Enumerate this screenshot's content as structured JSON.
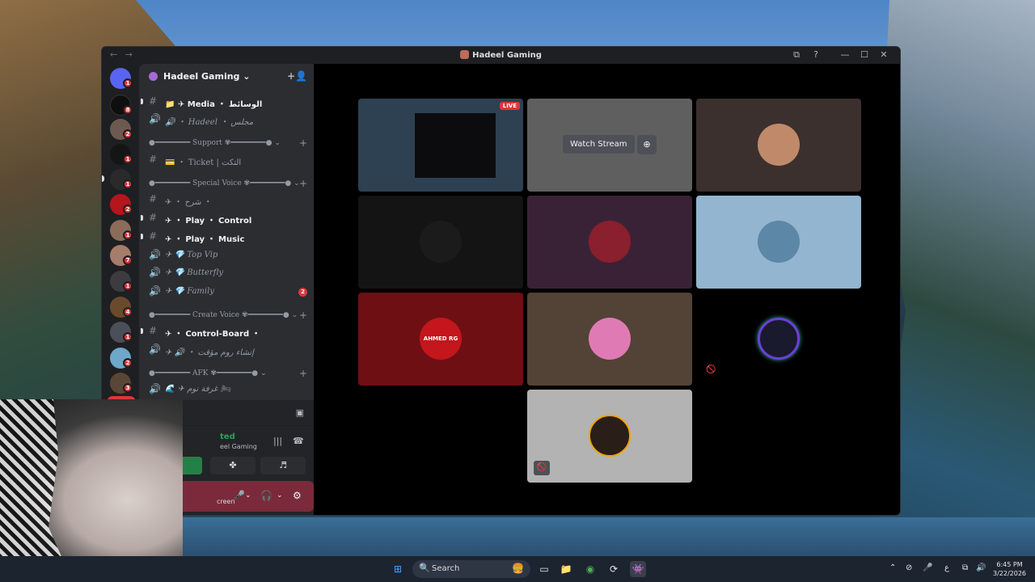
{
  "window": {
    "title": "Hadeel Gaming",
    "nav_back": "←",
    "nav_forward": "→",
    "controls": [
      "⧉",
      "?",
      "—",
      "☐",
      "✕"
    ]
  },
  "rail": {
    "badges": [
      "1",
      "8",
      "2",
      "1",
      "1",
      "2",
      "1",
      "7",
      "1",
      "4",
      "1",
      "2",
      "3"
    ],
    "new_label": "NEW"
  },
  "server": {
    "name": "Hadeel Gaming",
    "chevron": "⌄",
    "invite_icon": "+👤"
  },
  "channels": [
    {
      "icon": "#",
      "label": "📁 ✈ Media ・ الوسائط",
      "type": "text bold",
      "pinned": true
    },
    {
      "icon": "🔊",
      "label": "🔊 ・ Hadeel ・ مجلس",
      "type": "voice",
      "pinned": false
    },
    {
      "icon": "#",
      "label": "💳 ・ Ticket | التكت",
      "type": "text muted",
      "pinned": false
    },
    {
      "icon": "#",
      "label": "✈ ・ شرح ・",
      "type": "text muted",
      "pinned": false
    },
    {
      "icon": "#",
      "label": "✈ ・ Play ・ Control",
      "type": "text bold",
      "pinned": true
    },
    {
      "icon": "#",
      "label": "✈ ・ Play ・ Music",
      "type": "text bold",
      "pinned": true
    },
    {
      "icon": "🔊",
      "label": "✈ 💎 Top Vip",
      "type": "voice",
      "pinned": false
    },
    {
      "icon": "🔊",
      "label": "✈ 💎 Butterfly",
      "type": "voice",
      "pinned": false
    },
    {
      "icon": "🔊",
      "label": "✈ 💎 Family",
      "type": "voice",
      "pinned": false,
      "badge": "2"
    },
    {
      "icon": "#",
      "label": "✈ ・ Control-Board ・",
      "type": "text bold",
      "pinned": true
    },
    {
      "icon": "🔊",
      "label": "✈ 🔊 ・ إنشاء روم مؤقت",
      "type": "voice muted",
      "pinned": false
    },
    {
      "icon": "🔊",
      "label": "🌊 ✈ غرفة نوم 🛏",
      "type": "voice muted",
      "pinned": false
    }
  ],
  "categories": [
    {
      "label": "●━━━━━━━━ Support ✾━━━━━━━━● ⌄"
    },
    {
      "label": "●━━━━━━━━ Special Voice ✾━━━━━━━━● ⌄"
    },
    {
      "label": "●━━━━━━━━ Create Voice ✾━━━━━━━━● ⌄"
    },
    {
      "label": "●━━━━━━━━ AFK ✾━━━━━━━━● ⌄"
    }
  ],
  "voice_panel": {
    "status": "ted",
    "server": "eel Gaming",
    "screen_label": "creen",
    "wave_icon": "|||",
    "hangup_icon": "☎",
    "screen_share_icon": "▣",
    "activity_icon": "✤",
    "soundboard_icon": "♬",
    "mic_icon": "🎤",
    "headphone_icon": "🎧",
    "settings_icon": "⚙",
    "chev": "⌄"
  },
  "stage": {
    "live_label": "LIVE",
    "watch_label": "Watch Stream",
    "watch_icon": "⊕",
    "mute_icon": "🚫",
    "tile_colors": [
      "#2d4152",
      "#5f5f60",
      "#3b302e",
      "#141414",
      "#3a2236",
      "#93b5cf",
      "#6e0f14",
      "#524336",
      "#000000",
      "#b3b3b3"
    ],
    "avatar_colors": [
      "#c08a6a",
      "#1b1b1b",
      "#8a1f2e",
      "#5c87a6",
      "#c4161c",
      "#e07ab4",
      "#1a1a2e",
      "#2a1e18"
    ],
    "avatar_text": "AHMED RG"
  },
  "taskbar": {
    "search_label": "Search",
    "search_icon": "🔍",
    "start_icon": "⊞",
    "apps": [
      "🍔",
      "▭",
      "📁",
      "◉",
      "⟳",
      "👾"
    ],
    "tray": [
      "⌃",
      "⊘",
      "🎤",
      "ع",
      "⧉",
      "🔊"
    ],
    "time": "6:45 PM",
    "date": "3/22/2026"
  }
}
